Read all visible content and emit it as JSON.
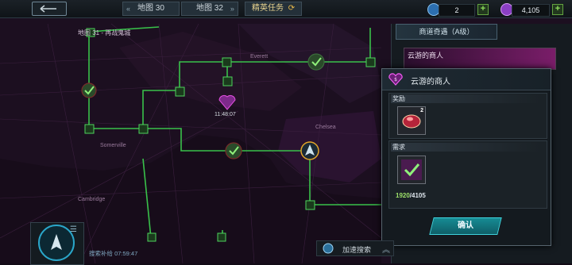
{
  "top_bar": {
    "tabs": [
      {
        "label": "地图 30"
      },
      {
        "label": "地图 32"
      },
      {
        "label": "精英任务"
      }
    ],
    "resources": [
      {
        "name": "crystal",
        "value": "2",
        "color": "#2c6fb0"
      },
      {
        "name": "gem",
        "value": "4,105",
        "color": "#8b3fc4"
      }
    ]
  },
  "map": {
    "zone_label": "地图 31 - 再战鬼城",
    "timer": "11:48:07",
    "district_labels": [
      "Everett",
      "Chelsea",
      "Somerville",
      "Cambridge"
    ],
    "accent_color": "#39c14a"
  },
  "side_panel": {
    "header": "商道奇遇（A级）",
    "item_label": "云游的商人"
  },
  "popup": {
    "title": "云游的商人",
    "reward_label": "奖励",
    "reward_count": "2",
    "requirement_label": "需求",
    "requirement_have": "1920",
    "requirement_sep": "/",
    "requirement_need": "4105",
    "confirm": "确认"
  },
  "bottom": {
    "search_status": "搜索补给 07:59:47",
    "fast_search": "加速搜索"
  }
}
